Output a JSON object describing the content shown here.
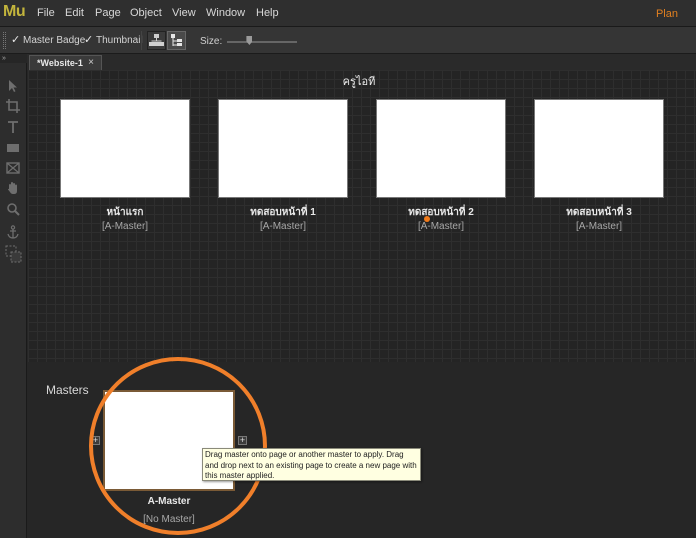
{
  "app": {
    "logo": "Mu",
    "plan_label": "Plan"
  },
  "menu": [
    "File",
    "Edit",
    "Page",
    "Object",
    "View",
    "Window",
    "Help"
  ],
  "toolbar": {
    "master_badge_label": "Master Badge",
    "master_badge_checked": true,
    "thumbnail_label": "Thumbnail",
    "thumbnail_checked": true,
    "size_label": "Size:",
    "size_level": 0.32
  },
  "tools": [
    "selection-tool",
    "crop-tool",
    "text-tool",
    "rectangle-tool",
    "image-frame-tool",
    "hand-tool",
    "zoom-tool",
    "anchor-tool",
    "fill-stroke-tool"
  ],
  "document": {
    "tab_label": "*Website-1",
    "close_glyph": "×"
  },
  "site": {
    "title": "ครูไอที",
    "pages": [
      {
        "name": "หน้าแรก",
        "master": "[A-Master]"
      },
      {
        "name": "ทดสอบหน้าที่ 1",
        "master": "[A-Master]"
      },
      {
        "name": "ทดสอบหน้าที่ 2",
        "master": "[A-Master]"
      },
      {
        "name": "ทดสอบหน้าที่ 3",
        "master": "[A-Master]"
      }
    ]
  },
  "masters": {
    "label": "Masters",
    "items": [
      {
        "name": "A-Master",
        "sub": "[No Master]"
      }
    ],
    "tooltip": "Drag master onto page or another master to apply. Drag and drop next to an existing page to create a new page with this master applied."
  },
  "colors": {
    "accent": "#f07f2a",
    "logo": "#c3b53c",
    "tooltip_bg": "#ffffe1"
  }
}
